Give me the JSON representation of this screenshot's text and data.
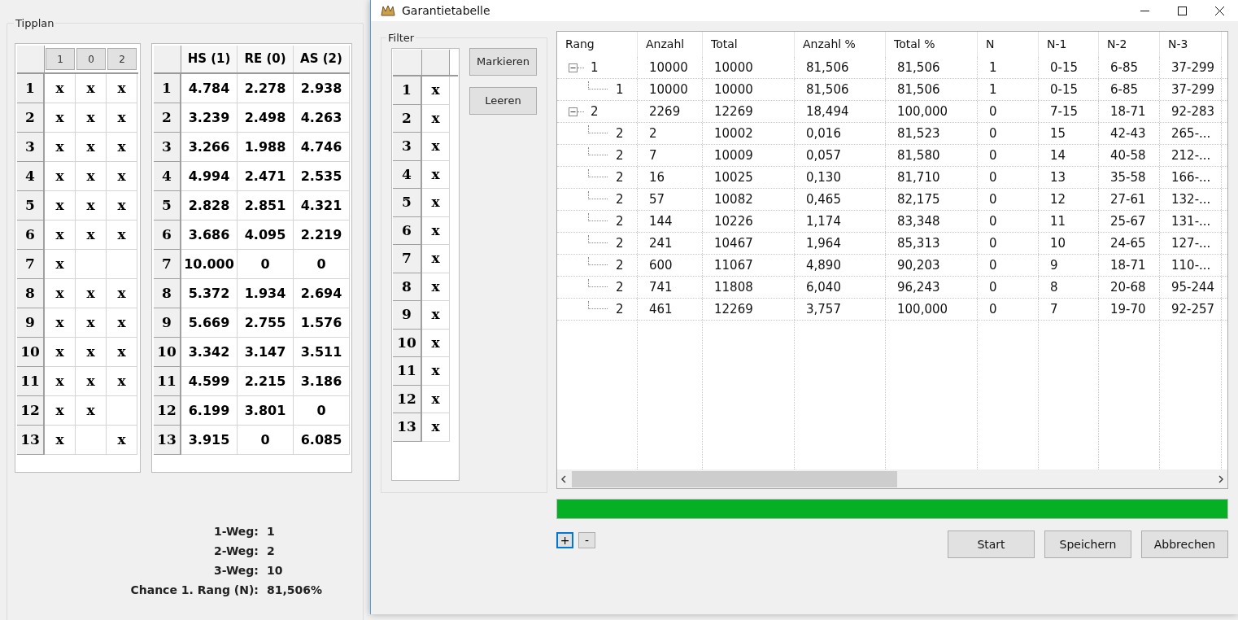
{
  "tipplan": {
    "title": "Tipplan",
    "pick_headers": [
      {
        "label": "1"
      },
      {
        "label": "0"
      },
      {
        "label": "2"
      }
    ],
    "pick_rows": [
      {
        "number": "1",
        "cells": [
          "x",
          "x",
          "x"
        ]
      },
      {
        "number": "2",
        "cells": [
          "x",
          "x",
          "x"
        ]
      },
      {
        "number": "3",
        "cells": [
          "x",
          "x",
          "x"
        ]
      },
      {
        "number": "4",
        "cells": [
          "x",
          "x",
          "x"
        ]
      },
      {
        "number": "5",
        "cells": [
          "x",
          "x",
          "x"
        ]
      },
      {
        "number": "6",
        "cells": [
          "x",
          "x",
          "x"
        ]
      },
      {
        "number": "7",
        "cells": [
          "x",
          null,
          null
        ]
      },
      {
        "number": "8",
        "cells": [
          "x",
          "x",
          "x"
        ]
      },
      {
        "number": "9",
        "cells": [
          "x",
          "x",
          "x"
        ]
      },
      {
        "number": "10",
        "cells": [
          "x",
          "x",
          "x"
        ]
      },
      {
        "number": "11",
        "cells": [
          "x",
          "x",
          "x"
        ]
      },
      {
        "number": "12",
        "cells": [
          "x",
          "x",
          null
        ]
      },
      {
        "number": "13",
        "cells": [
          "x",
          null,
          "x"
        ]
      }
    ],
    "odds_headers": [
      "HS (1)",
      "RE (0)",
      "AS (2)"
    ],
    "odds_rows": [
      {
        "number": "1",
        "values": [
          "4.784",
          "2.278",
          "2.938"
        ]
      },
      {
        "number": "2",
        "values": [
          "3.239",
          "2.498",
          "4.263"
        ]
      },
      {
        "number": "3",
        "values": [
          "3.266",
          "1.988",
          "4.746"
        ]
      },
      {
        "number": "4",
        "values": [
          "4.994",
          "2.471",
          "2.535"
        ]
      },
      {
        "number": "5",
        "values": [
          "2.828",
          "2.851",
          "4.321"
        ]
      },
      {
        "number": "6",
        "values": [
          "3.686",
          "4.095",
          "2.219"
        ]
      },
      {
        "number": "7",
        "values": [
          "10.000",
          "0",
          "0"
        ]
      },
      {
        "number": "8",
        "values": [
          "5.372",
          "1.934",
          "2.694"
        ]
      },
      {
        "number": "9",
        "values": [
          "5.669",
          "2.755",
          "1.576"
        ]
      },
      {
        "number": "10",
        "values": [
          "3.342",
          "3.147",
          "3.511"
        ]
      },
      {
        "number": "11",
        "values": [
          "4.599",
          "2.215",
          "3.186"
        ]
      },
      {
        "number": "12",
        "values": [
          "6.199",
          "3.801",
          "0"
        ]
      },
      {
        "number": "13",
        "values": [
          "3.915",
          "0",
          "6.085"
        ]
      }
    ],
    "summary": [
      {
        "label": "1-Weg:",
        "value": "1"
      },
      {
        "label": "2-Weg:",
        "value": "2"
      },
      {
        "label": "3-Weg:",
        "value": "10"
      },
      {
        "label": "Chance 1. Rang (N):",
        "value": "81,506%"
      }
    ]
  },
  "dialog": {
    "title": "Garantietabelle",
    "filter": {
      "title": "Filter",
      "rows": [
        {
          "number": "1",
          "mark": "x"
        },
        {
          "number": "2",
          "mark": "x"
        },
        {
          "number": "3",
          "mark": "x"
        },
        {
          "number": "4",
          "mark": "x"
        },
        {
          "number": "5",
          "mark": "x"
        },
        {
          "number": "6",
          "mark": "x"
        },
        {
          "number": "7",
          "mark": "x"
        },
        {
          "number": "8",
          "mark": "x"
        },
        {
          "number": "9",
          "mark": "x"
        },
        {
          "number": "10",
          "mark": "x"
        },
        {
          "number": "11",
          "mark": "x"
        },
        {
          "number": "12",
          "mark": "x"
        },
        {
          "number": "13",
          "mark": "x"
        }
      ],
      "buttons": [
        "Markieren",
        "Leeren"
      ]
    },
    "table": {
      "columns": [
        "Rang",
        "Anzahl",
        "Total",
        "Anzahl %",
        "Total %",
        "N",
        "N-1",
        "N-2",
        "N-3"
      ],
      "groups": [
        {
          "expanded": true,
          "cells": [
            "1",
            "10000",
            "10000",
            "81,506",
            "81,506",
            "1",
            "0-15",
            "6-85",
            "37-299"
          ],
          "children": [
            {
              "cells": [
                "1",
                "10000",
                "10000",
                "81,506",
                "81,506",
                "1",
                "0-15",
                "6-85",
                "37-299"
              ]
            }
          ]
        },
        {
          "expanded": true,
          "cells": [
            "2",
            "2269",
            "12269",
            "18,494",
            "100,000",
            "0",
            "7-15",
            "18-71",
            "92-283"
          ],
          "children": [
            {
              "cells": [
                "2",
                "2",
                "10002",
                "0,016",
                "81,523",
                "0",
                "15",
                "42-43",
                "265-..."
              ]
            },
            {
              "cells": [
                "2",
                "7",
                "10009",
                "0,057",
                "81,580",
                "0",
                "14",
                "40-58",
                "212-..."
              ]
            },
            {
              "cells": [
                "2",
                "16",
                "10025",
                "0,130",
                "81,710",
                "0",
                "13",
                "35-58",
                "166-..."
              ]
            },
            {
              "cells": [
                "2",
                "57",
                "10082",
                "0,465",
                "82,175",
                "0",
                "12",
                "27-61",
                "132-..."
              ]
            },
            {
              "cells": [
                "2",
                "144",
                "10226",
                "1,174",
                "83,348",
                "0",
                "11",
                "25-67",
                "131-..."
              ]
            },
            {
              "cells": [
                "2",
                "241",
                "10467",
                "1,964",
                "85,313",
                "0",
                "10",
                "24-65",
                "127-..."
              ]
            },
            {
              "cells": [
                "2",
                "600",
                "11067",
                "4,890",
                "90,203",
                "0",
                "9",
                "18-71",
                "110-..."
              ]
            },
            {
              "cells": [
                "2",
                "741",
                "11808",
                "6,040",
                "96,243",
                "0",
                "8",
                "20-68",
                "95-244"
              ]
            },
            {
              "cells": [
                "2",
                "461",
                "12269",
                "3,757",
                "100,000",
                "0",
                "7",
                "19-70",
                "92-257"
              ]
            }
          ]
        }
      ]
    },
    "progress": {
      "level": 1.0
    },
    "tree_buttons": [
      {
        "label": "+",
        "focused": true
      },
      {
        "label": "-",
        "focused": false
      }
    ],
    "buttons": [
      "Start",
      "Speichern",
      "Abbrechen"
    ]
  }
}
